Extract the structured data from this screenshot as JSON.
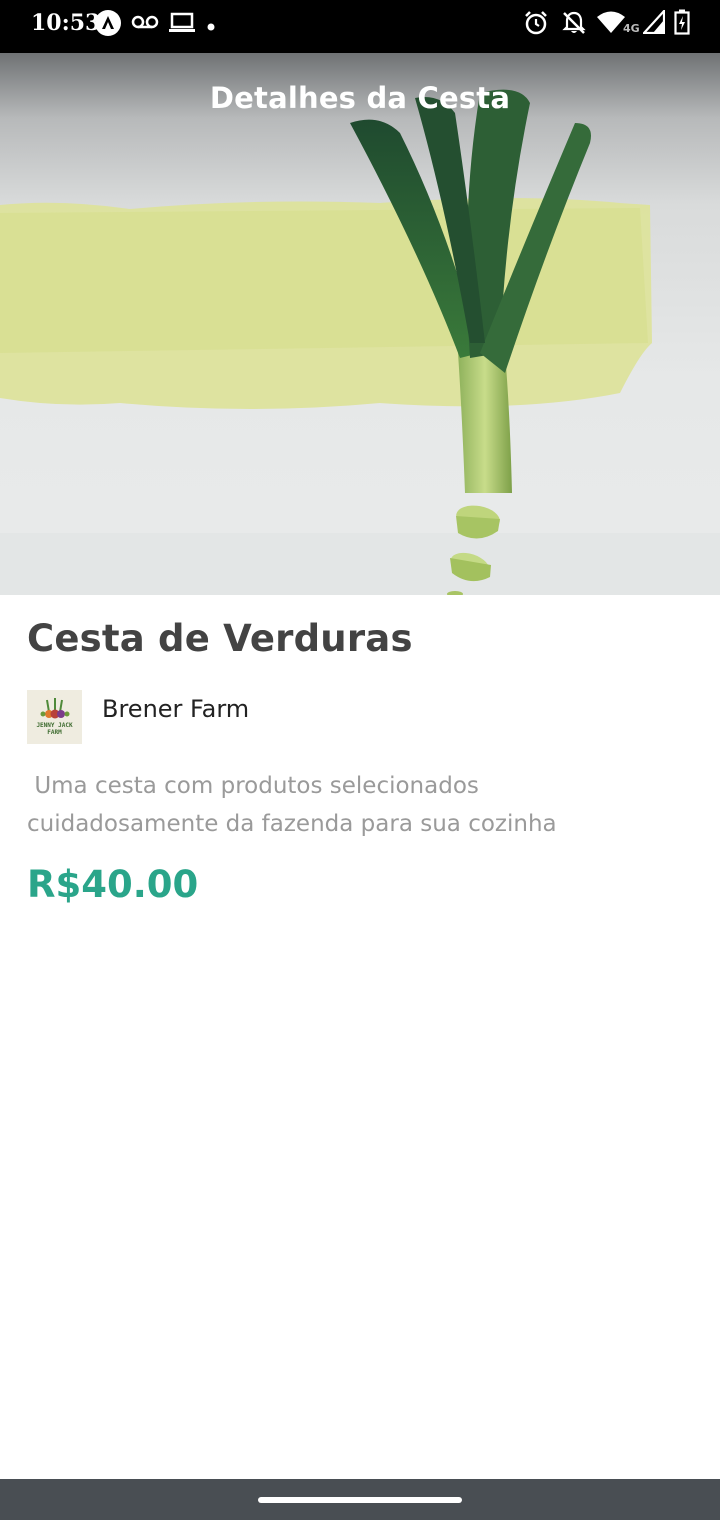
{
  "status_bar": {
    "time": "10:53",
    "network_label": "4G",
    "icons": [
      "autoplay-icon",
      "voicemail-icon",
      "laptop-icon",
      "dot-icon",
      "alarm-icon",
      "notifications-off-icon",
      "wifi-icon",
      "signal-icon",
      "battery-charging-icon"
    ]
  },
  "header": {
    "title": "Detalhes da Cesta"
  },
  "product": {
    "name": "Cesta de Verduras",
    "farm": {
      "name": "Brener Farm",
      "logo_text": "JENNY JACK FARM"
    },
    "description": " Uma cesta com produtos selecionados\ncuidadosamente da fazenda para sua cozinha",
    "price": "R$40.00"
  },
  "colors": {
    "price": "#2aa58a",
    "title": "#434343",
    "description": "#9a9a9a",
    "nav_bar": "#494e53"
  }
}
